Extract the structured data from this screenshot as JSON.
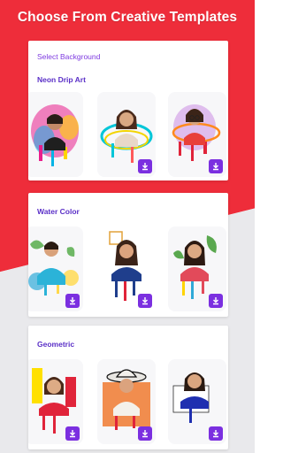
{
  "headline": "Choose From Creative Templates",
  "select_background": "Select Background",
  "sections": [
    {
      "title": "Neon Drip Art"
    },
    {
      "title": "Water Color"
    },
    {
      "title": "Geometric"
    }
  ],
  "colors": {
    "accent_red": "#ee2d3a",
    "accent_purple": "#7b2fe0",
    "title_purple": "#5a2fc7"
  },
  "icons": {
    "download": "download-icon"
  }
}
